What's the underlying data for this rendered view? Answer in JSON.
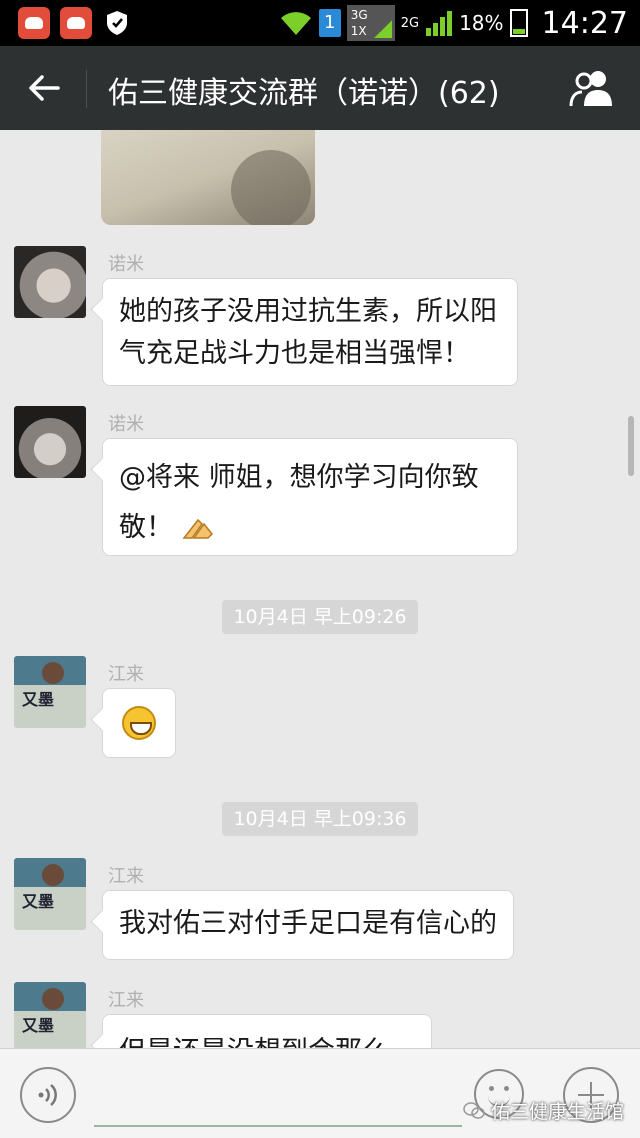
{
  "status_bar": {
    "sim_slot": "1",
    "network_top": "3G",
    "network_bottom": "1X",
    "network_2g": "2G",
    "battery_percent": "18%",
    "time": "14:27"
  },
  "header": {
    "title": "佑三健康交流群（诺诺）(62)",
    "back_icon": "arrow-left-icon",
    "members_icon": "group-members-icon"
  },
  "messages": [
    {
      "sender": "诺米",
      "text": "她的孩子没用过抗生素，所以阳气充足战斗力也是相当强悍！"
    },
    {
      "sender": "诺米",
      "text": "@将来 师姐，想你学习向你致敬！"
    },
    {
      "timestamp": "10月4日 早上09:26"
    },
    {
      "sender": "江来",
      "emoji": "grin-emoji"
    },
    {
      "timestamp": "10月4日 早上09:36"
    },
    {
      "sender": "江来",
      "text": "我对佑三对付手足口是有信心的"
    },
    {
      "sender": "江来",
      "text": "但是还是没想到会那么快"
    }
  ],
  "watermark": "佑三健康生活馆",
  "colors": {
    "title_bar": "#2d3132",
    "status_bar": "#000000",
    "chat_bg": "#e9e9e9",
    "bubble": "#ffffff",
    "timestamp_bg": "#d6d6d6"
  }
}
